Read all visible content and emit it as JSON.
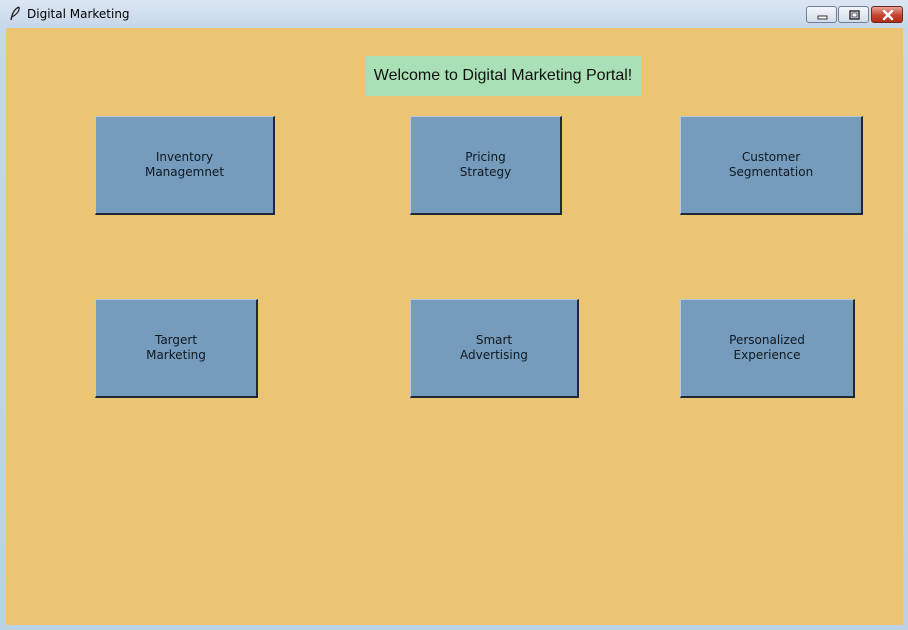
{
  "window": {
    "title": "Digital Marketing",
    "icon": "feather-icon",
    "controls": [
      "minimize-icon",
      "maximize-icon",
      "close-icon"
    ]
  },
  "colors": {
    "background": "#ecc572",
    "welcome_bg": "#a9e0b5",
    "tile_bg": "#759cbc"
  },
  "main": {
    "welcome": "Welcome to Digital Marketing Portal!",
    "tiles": [
      {
        "line1": "Inventory",
        "line2": "Managemnet"
      },
      {
        "line1": "Pricing",
        "line2": "Strategy"
      },
      {
        "line1": "Customer",
        "line2": "Segmentation"
      },
      {
        "line1": "Targert",
        "line2": "Marketing"
      },
      {
        "line1": "Smart",
        "line2": "Advertising"
      },
      {
        "line1": "Personalized",
        "line2": "Experience"
      }
    ]
  }
}
